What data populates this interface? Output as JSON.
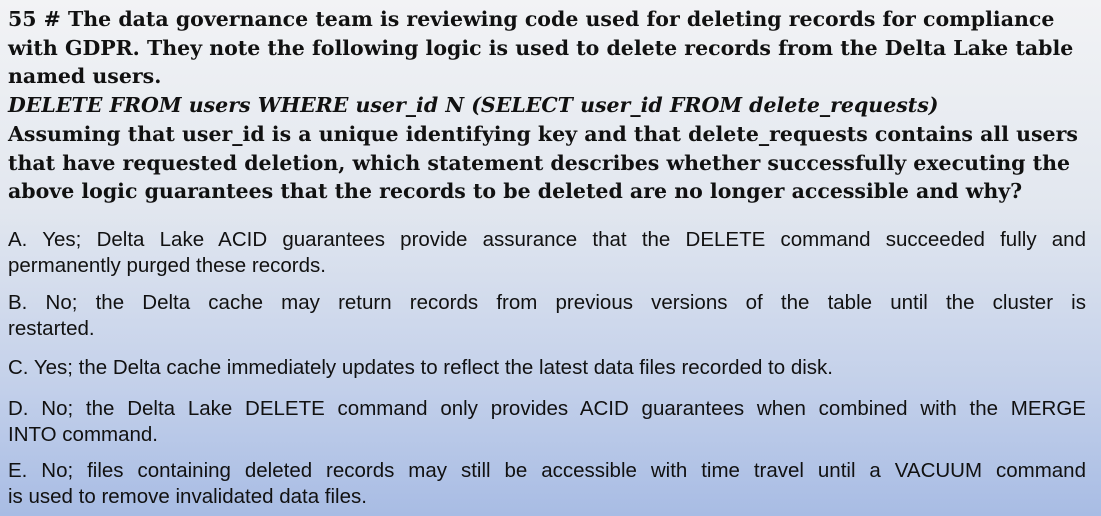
{
  "question": {
    "lines": [
      "55 # The data governance team is reviewing code used for deleting records for compliance",
      "with GDPR. They note the following logic is used to delete records from the Delta Lake table",
      "named users."
    ],
    "code": "DELETE FROM users WHERE user_id N (SELECT user_id FROM delete_requests)",
    "body_lines": [
      "Assuming that user_id is a unique identifying key and that delete_requests contains all users",
      "that have requested deletion, which statement describes whether successfully executing the",
      "above logic guarantees that the records to be deleted are no longer accessible and why?"
    ]
  },
  "options": [
    {
      "l1": "A. Yes; Delta Lake ACID guarantees provide assurance that the DELETE command succeeded fully and",
      "l2": "permanently purged these records."
    },
    {
      "l1": "B. No; the Delta cache may return records from previous versions of the table until the cluster is",
      "l2": "restarted."
    },
    {
      "l1": "",
      "l2": "C. Yes; the Delta cache immediately updates to reflect the latest data files recorded to disk."
    },
    {
      "l1": "D. No; the Delta Lake DELETE command only provides ACID guarantees when combined with the MERGE",
      "l2": "INTO command."
    },
    {
      "l1": "E. No; files containing deleted records may still be accessible with time travel until a VACUUM command",
      "l2": "is used to remove invalidated data files."
    }
  ]
}
